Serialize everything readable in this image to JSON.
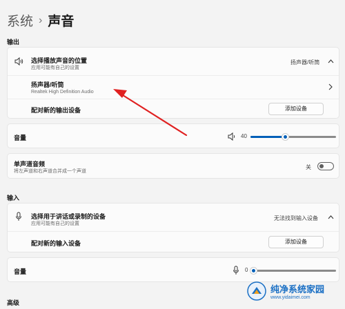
{
  "breadcrumb": {
    "parent": "系统",
    "separator": "›",
    "current": "声音"
  },
  "output": {
    "section_label": "输出",
    "choose_device": {
      "title": "选择播放声音的位置",
      "subtitle": "应用可能有自己的设置",
      "value": "扬声器/听筒"
    },
    "device_item": {
      "title": "扬声器/听筒",
      "subtitle": "Realtek High Definition Audio"
    },
    "pair_new": {
      "label": "配对新的输出设备",
      "button": "添加设备"
    },
    "volume": {
      "label": "音量",
      "value": "40",
      "level_percent": 40
    },
    "mono": {
      "title": "单声道音频",
      "subtitle": "将左声道和右声道合并成一个声道",
      "state": "关"
    }
  },
  "input": {
    "section_label": "输入",
    "choose_device": {
      "title": "选择用于讲话或录制的设备",
      "subtitle": "应用可能有自己的设置",
      "value": "无法找到输入设备"
    },
    "pair_new": {
      "label": "配对新的输入设备",
      "button": "添加设备"
    },
    "volume": {
      "label": "音量",
      "value": "0",
      "level_percent": 0
    }
  },
  "advanced": {
    "section_label": "高级"
  },
  "watermark": {
    "name": "纯净系统家园",
    "url": "www.yidaimei.com"
  },
  "colors": {
    "accent": "#005fb8",
    "annotation_arrow": "#e02020",
    "watermark": "#1a6fc4"
  }
}
